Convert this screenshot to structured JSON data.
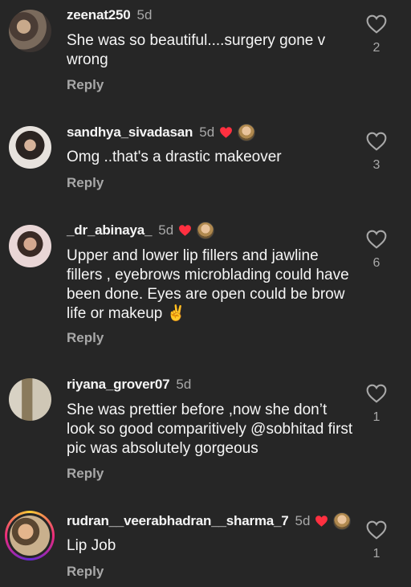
{
  "comments": [
    {
      "username": "zeenat250",
      "time": "5d",
      "text": "She was so beautiful....surgery gone v wrong",
      "reply": "Reply",
      "likes": "2",
      "creator_liked": false,
      "avatar_colors": [
        "#7a6a5c",
        "#3b3431"
      ]
    },
    {
      "username": "sandhya_sivadasan",
      "time": "5d",
      "text": "Omg ..that's a drastic makeover",
      "reply": "Reply",
      "likes": "3",
      "creator_liked": true,
      "avatar_colors": [
        "#e7e2dd",
        "#2b2421"
      ]
    },
    {
      "username": "_dr_abinaya_",
      "time": "5d",
      "text": "Upper and lower lip fillers and jawline fillers , eyebrows microblading could have been done. Eyes are open could be brow life or makeup ✌️",
      "reply": "Reply",
      "likes": "6",
      "creator_liked": true,
      "avatar_colors": [
        "#e9d6d6",
        "#b48e86"
      ]
    },
    {
      "username": "riyana_grover07",
      "time": "5d",
      "text": "She was prettier before ,now she don’t look so good comparitively @sobhitad first pic was absolutely gorgeous",
      "reply": "Reply",
      "likes": "1",
      "creator_liked": false,
      "avatar_colors": [
        "#d8d2c4",
        "#8a7a5c"
      ]
    },
    {
      "username": "rudran__veerabhadran__sharma_7",
      "time": "5d",
      "text": "Lip Job",
      "reply": "Reply",
      "likes": "1",
      "creator_liked": true,
      "avatar_colors": [
        "#c9b08d",
        "#5a4631"
      ]
    }
  ],
  "icons": {
    "like": "heart-outline-icon",
    "creator_like": "red-heart-icon"
  },
  "colors": {
    "background": "#262626",
    "secondary_text": "#a8a8a8",
    "heart_red": "#ff3040"
  }
}
